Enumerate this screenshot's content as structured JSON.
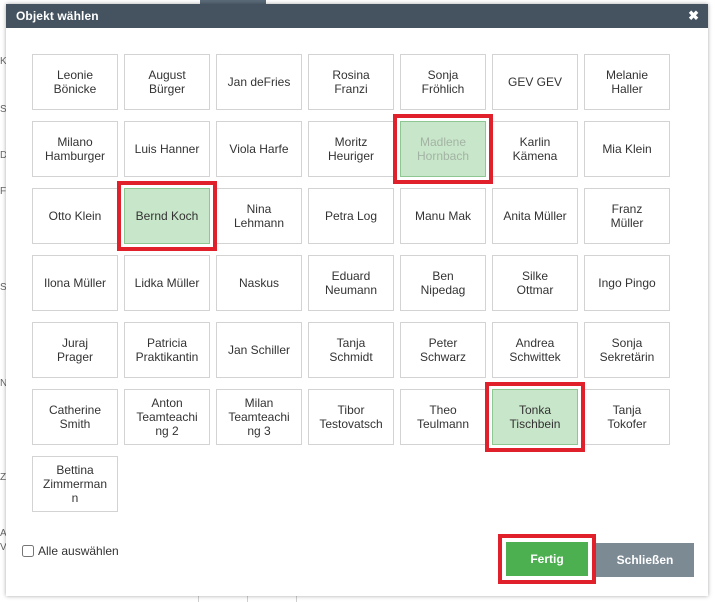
{
  "dialog": {
    "title": "Objekt wählen",
    "close_symbol": "✖",
    "select_all_label": "Alle auswählen",
    "select_all_checked": false,
    "buttons": {
      "confirm_label": "Fertig",
      "close_label": "Schließen"
    }
  },
  "background": {
    "letters": [
      "K",
      "S",
      "D",
      "F",
      "S",
      "N",
      "Z",
      "A",
      "V"
    ]
  },
  "items": [
    {
      "label": "Leonie\nBönicke",
      "selected": false,
      "disabled": false
    },
    {
      "label": "August\nBürger",
      "selected": false,
      "disabled": false
    },
    {
      "label": "Jan deFries",
      "selected": false,
      "disabled": false
    },
    {
      "label": "Rosina\nFranzi",
      "selected": false,
      "disabled": false
    },
    {
      "label": "Sonja\nFröhlich",
      "selected": false,
      "disabled": false
    },
    {
      "label": "GEV GEV",
      "selected": false,
      "disabled": false
    },
    {
      "label": "Melanie\nHaller",
      "selected": false,
      "disabled": false
    },
    {
      "label": "Milano\nHamburger",
      "selected": false,
      "disabled": false
    },
    {
      "label": "Luis Hanner",
      "selected": false,
      "disabled": false
    },
    {
      "label": "Viola Harfe",
      "selected": false,
      "disabled": false
    },
    {
      "label": "Moritz\nHeuriger",
      "selected": false,
      "disabled": false
    },
    {
      "label": "Madlene\nHornbach",
      "selected": true,
      "disabled": true
    },
    {
      "label": "Karlin\nKämena",
      "selected": false,
      "disabled": false
    },
    {
      "label": "Mia Klein",
      "selected": false,
      "disabled": false
    },
    {
      "label": "Otto Klein",
      "selected": false,
      "disabled": false
    },
    {
      "label": "Bernd Koch",
      "selected": true,
      "disabled": false
    },
    {
      "label": "Nina\nLehmann",
      "selected": false,
      "disabled": false
    },
    {
      "label": "Petra Log",
      "selected": false,
      "disabled": false
    },
    {
      "label": "Manu Mak",
      "selected": false,
      "disabled": false
    },
    {
      "label": "Anita Müller",
      "selected": false,
      "disabled": false
    },
    {
      "label": "Franz\nMüller",
      "selected": false,
      "disabled": false
    },
    {
      "label": "Ilona Müller",
      "selected": false,
      "disabled": false
    },
    {
      "label": "Lidka Müller",
      "selected": false,
      "disabled": false
    },
    {
      "label": "Naskus",
      "selected": false,
      "disabled": false
    },
    {
      "label": "Eduard\nNeumann",
      "selected": false,
      "disabled": false
    },
    {
      "label": "Ben\nNipedag",
      "selected": false,
      "disabled": false
    },
    {
      "label": "Silke\nOttmar",
      "selected": false,
      "disabled": false
    },
    {
      "label": "Ingo Pingo",
      "selected": false,
      "disabled": false
    },
    {
      "label": "Juraj\nPrager",
      "selected": false,
      "disabled": false
    },
    {
      "label": "Patricia\nPraktikantin",
      "selected": false,
      "disabled": false
    },
    {
      "label": "Jan Schiller",
      "selected": false,
      "disabled": false
    },
    {
      "label": "Tanja\nSchmidt",
      "selected": false,
      "disabled": false
    },
    {
      "label": "Peter\nSchwarz",
      "selected": false,
      "disabled": false
    },
    {
      "label": "Andrea\nSchwittek",
      "selected": false,
      "disabled": false
    },
    {
      "label": "Sonja\nSekretärin",
      "selected": false,
      "disabled": false
    },
    {
      "label": "Catherine\nSmith",
      "selected": false,
      "disabled": false
    },
    {
      "label": "Anton\nTeamteachi\nng 2",
      "selected": false,
      "disabled": false
    },
    {
      "label": "Milan\nTeamteachi\nng 3",
      "selected": false,
      "disabled": false
    },
    {
      "label": "Tibor\nTestovatsch",
      "selected": false,
      "disabled": false
    },
    {
      "label": "Theo\nTeulmann",
      "selected": false,
      "disabled": false
    },
    {
      "label": "Tonka\nTischbein",
      "selected": true,
      "disabled": false
    },
    {
      "label": "Tanja\nTokofer",
      "selected": false,
      "disabled": false
    },
    {
      "label": "Bettina\nZimmerman\nn",
      "selected": false,
      "disabled": false
    }
  ],
  "annotations": {
    "highlight_color": "#e0202a",
    "highlighted_items": [
      11,
      15,
      40
    ],
    "highlighted_buttons": [
      "confirm"
    ]
  },
  "colors": {
    "titlebar": "#44535f",
    "selected_fill": "#c8e6c9",
    "confirm_button": "#4caf50",
    "close_button": "#7c8a94"
  }
}
